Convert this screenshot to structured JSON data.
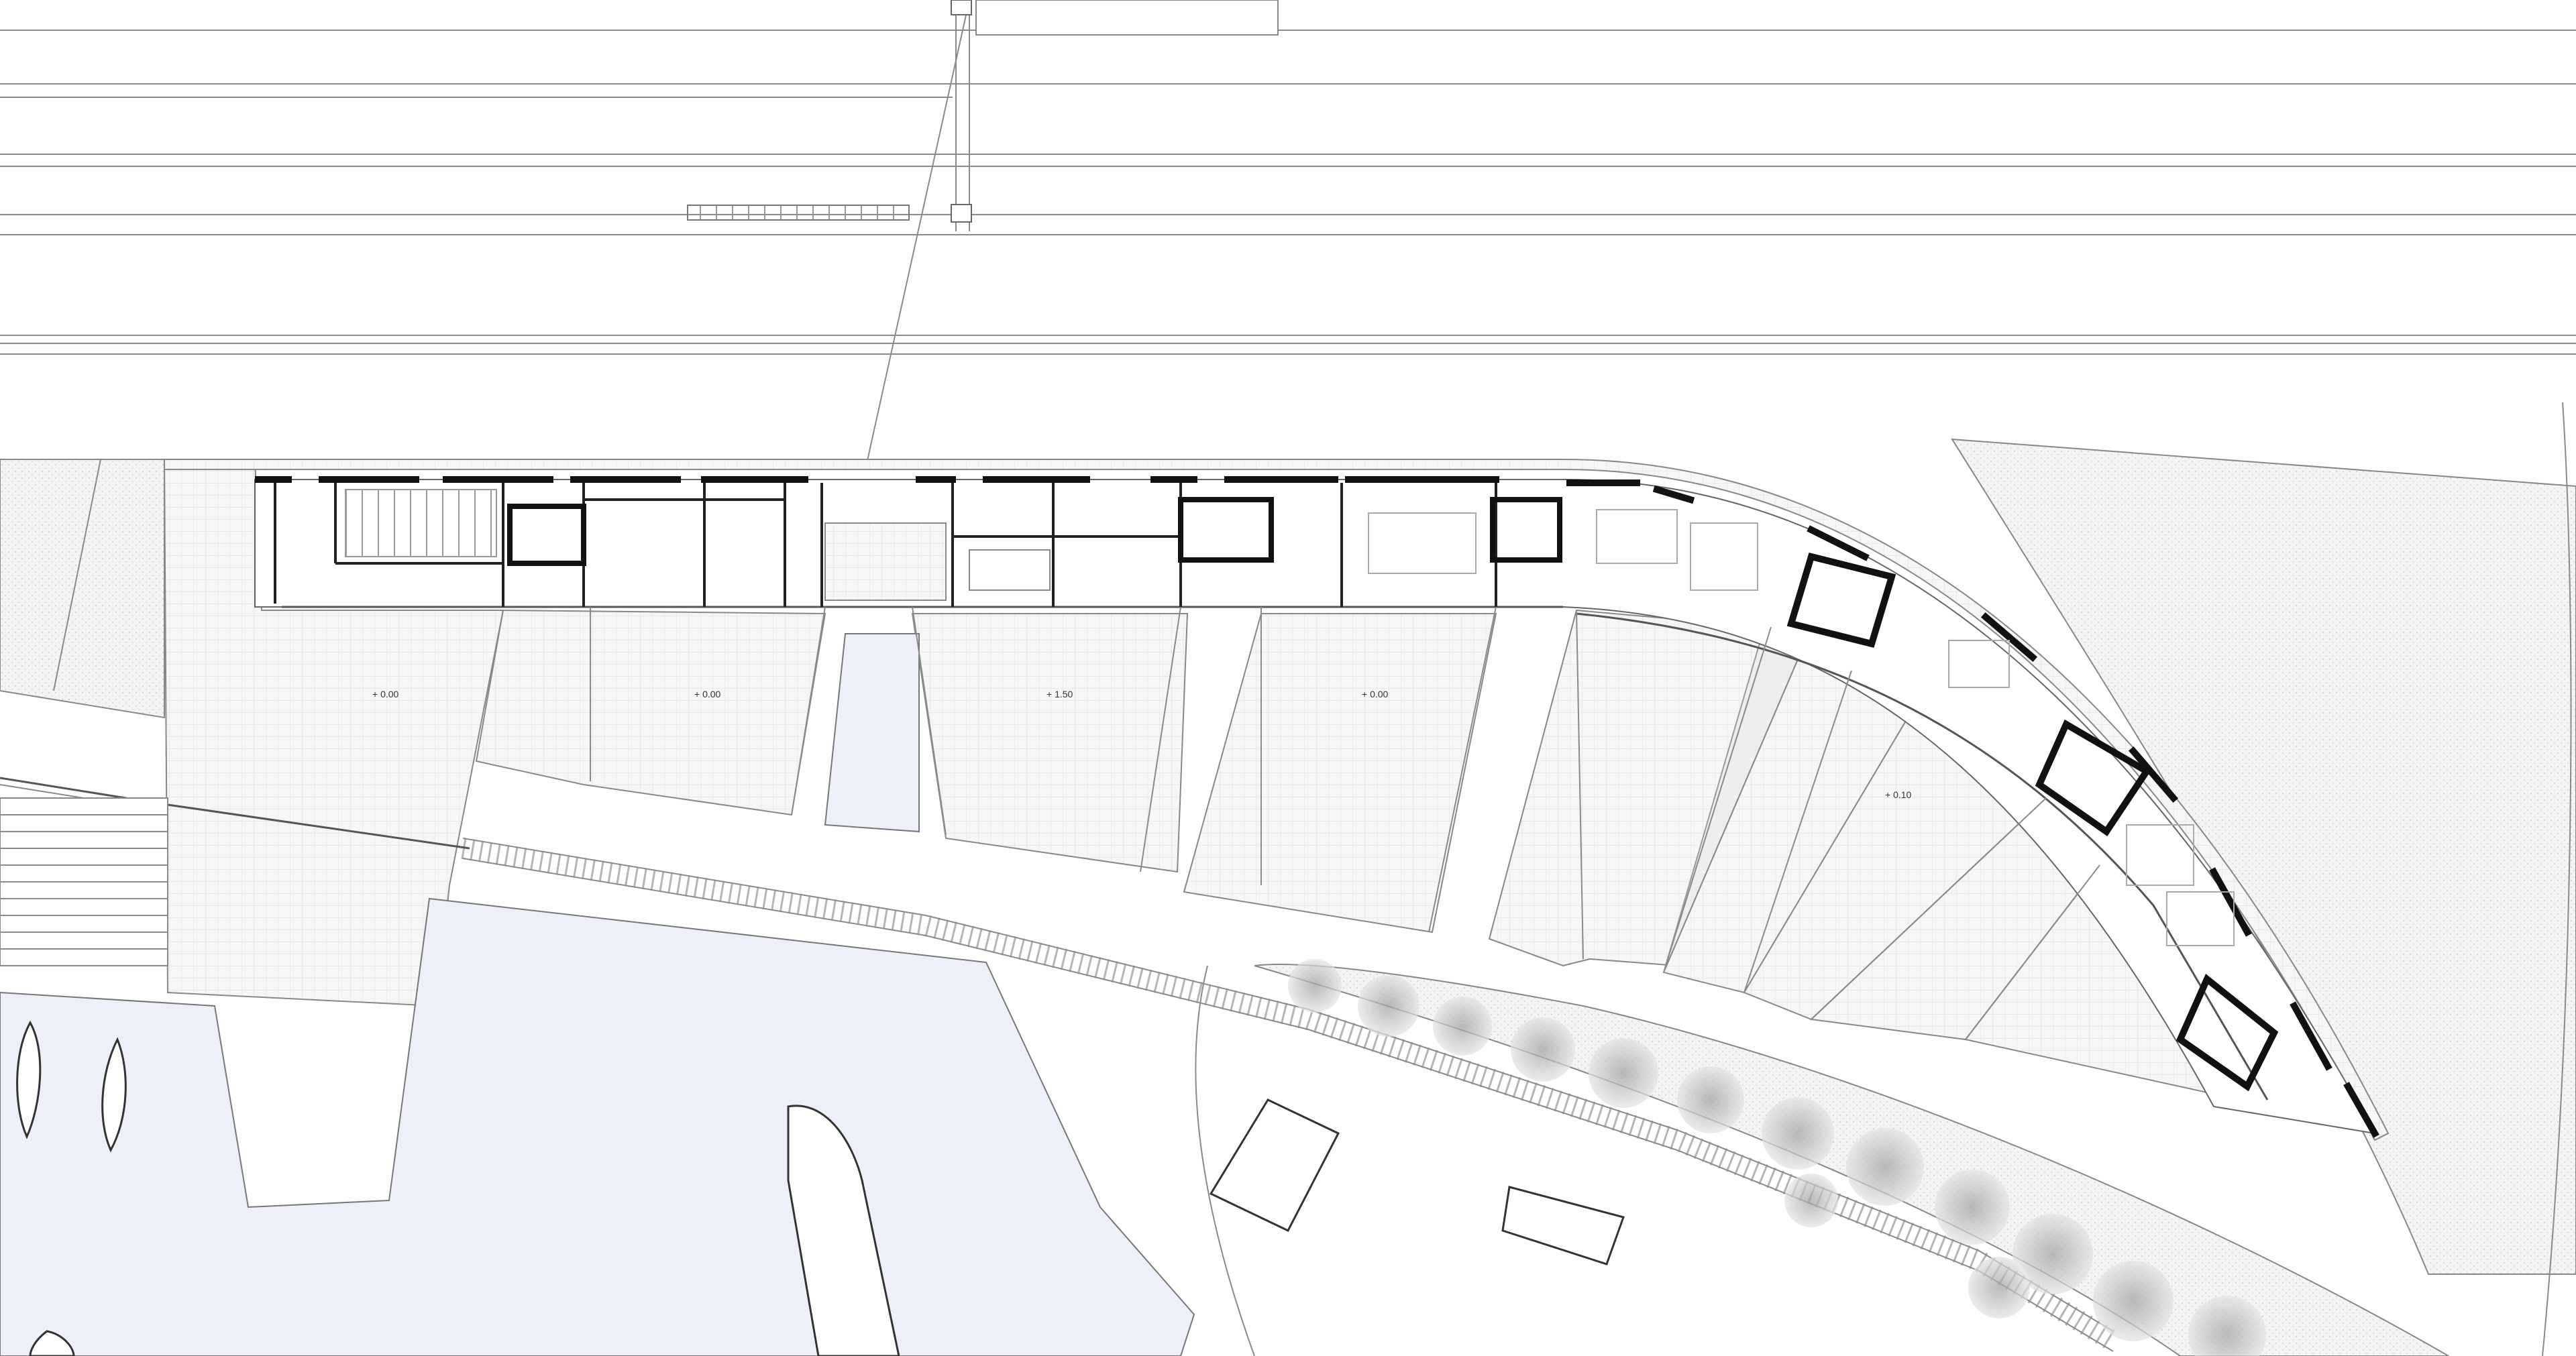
{
  "plan": {
    "level_labels": [
      "+ 0.00",
      "+ 0.00",
      "+ 1.50",
      "+ 0.00",
      "+ 0.10"
    ],
    "colors": {
      "water": "#edf0f8",
      "landscape": "#eeeeee",
      "walls": "#111111",
      "lines": "#8a8a8a",
      "vegetation": "#9a9a9a"
    }
  }
}
